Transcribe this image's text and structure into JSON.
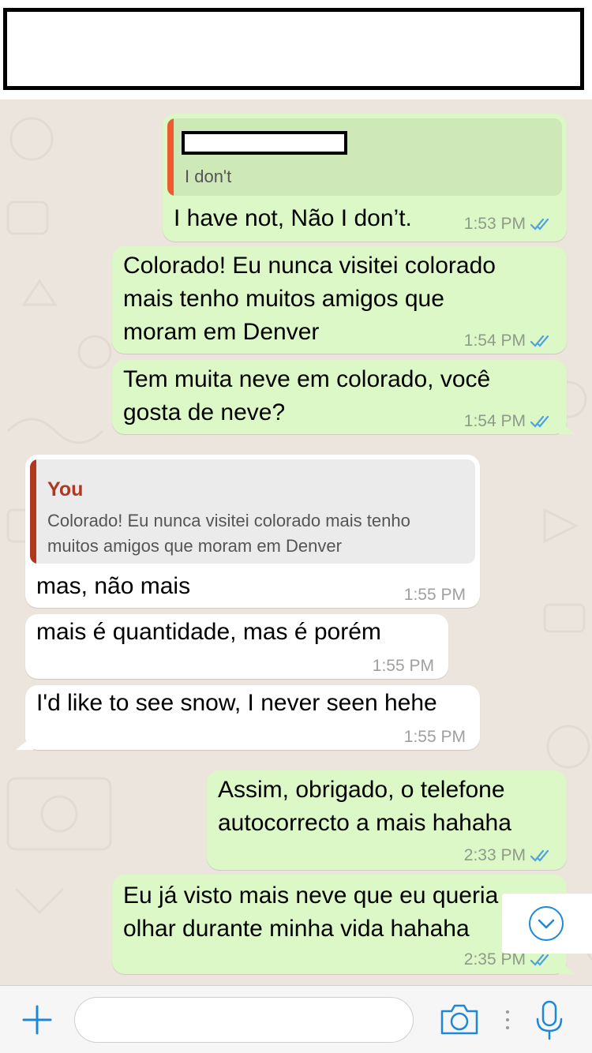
{
  "header": {
    "title": ""
  },
  "messages": [
    {
      "direction": "out",
      "quote": {
        "author": "",
        "text": "I don't"
      },
      "text": "I have not, Não I don’t.",
      "time": "1:53 PM"
    },
    {
      "direction": "out",
      "lines": [
        "Colorado! Eu nunca visitei colorado",
        "mais tenho muitos amigos que",
        "moram em Denver"
      ],
      "time": "1:54 PM"
    },
    {
      "direction": "out",
      "lines": [
        "Tem muita neve em colorado, você",
        "gosta de neve?"
      ],
      "time": "1:54 PM"
    },
    {
      "direction": "in",
      "quote": {
        "author": "You",
        "lines": [
          "Colorado! Eu nunca visitei colorado mais tenho",
          "muitos amigos que moram em Denver"
        ]
      },
      "text": "mas, não mais",
      "time": "1:55 PM"
    },
    {
      "direction": "in",
      "text": "mais é quantidade, mas é porém",
      "time": "1:55 PM"
    },
    {
      "direction": "in",
      "text": "I'd like to see snow, I never seen hehe",
      "time": "1:55 PM"
    },
    {
      "direction": "out",
      "lines": [
        "Assim, obrigado, o telefone",
        "autocorrecto a mais hahaha"
      ],
      "time": "2:33 PM"
    },
    {
      "direction": "out",
      "lines": [
        "Eu já visto mais neve que eu queria",
        "olhar durante minha vida hahaha"
      ],
      "time": "2:35 PM"
    }
  ],
  "composer": {
    "placeholder": "",
    "value": ""
  },
  "icons": {
    "read_receipt": "double-check-icon",
    "scroll": "chevron-down-icon",
    "add": "plus-icon",
    "camera": "camera-icon",
    "mic": "microphone-icon"
  },
  "colors": {
    "outgoing_bubble": "#DCF8C6",
    "incoming_bubble": "#FFFFFF",
    "background": "#ECE5DD",
    "read_tick": "#4FA3E0",
    "accent": "#1E88D8",
    "quote_bar_you": "#B0381E",
    "quote_bar_other": "#F05A30"
  }
}
